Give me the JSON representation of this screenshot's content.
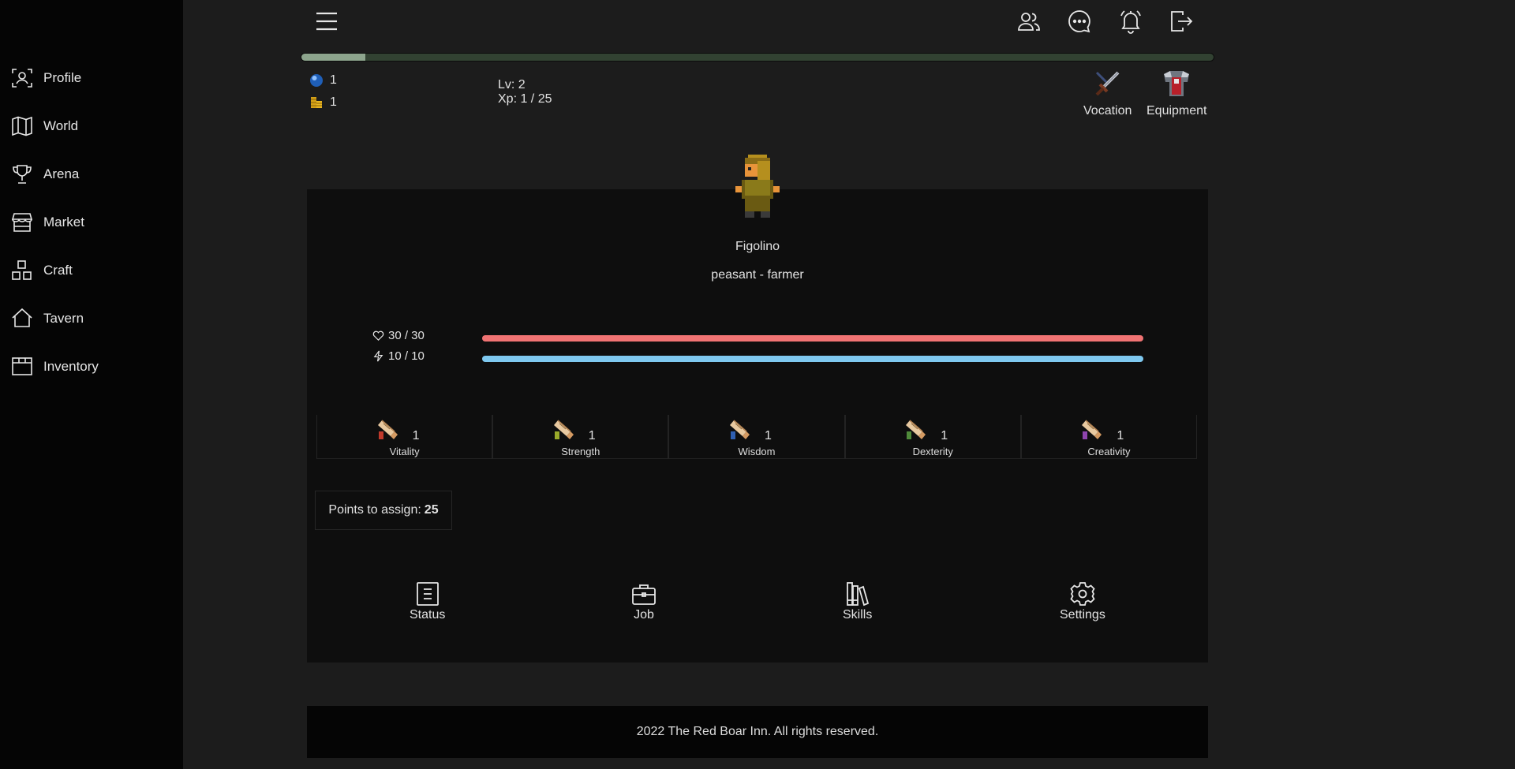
{
  "sidebar": {
    "items": [
      {
        "label": "Profile",
        "icon": "profile-icon"
      },
      {
        "label": "World",
        "icon": "map-icon"
      },
      {
        "label": "Arena",
        "icon": "trophy-icon"
      },
      {
        "label": "Market",
        "icon": "shop-icon"
      },
      {
        "label": "Craft",
        "icon": "blocks-icon"
      },
      {
        "label": "Tavern",
        "icon": "house-icon"
      },
      {
        "label": "Inventory",
        "icon": "box-icon"
      }
    ]
  },
  "topbar": {
    "icons": [
      "menu-icon",
      "friends-icon",
      "chat-icon",
      "notifications-icon",
      "logout-icon"
    ]
  },
  "xp_progress": 0.07,
  "currencies": {
    "orbs": "1",
    "gold": "1"
  },
  "level": {
    "lv_text": "Lv: 2",
    "xp_text": "Xp: 1 / 25"
  },
  "top_buttons": {
    "vocation": "Vocation",
    "equipment": "Equipment"
  },
  "character": {
    "name": "Figolino",
    "class": "peasant - farmer"
  },
  "stats": {
    "health": {
      "text": "30 / 30",
      "fraction": 1.0,
      "color": "#f07373"
    },
    "energy": {
      "text": "10 / 10",
      "fraction": 1.0,
      "color": "#7ec8ef"
    }
  },
  "attributes": [
    {
      "name": "Vitality",
      "value": "1",
      "color": "#c0392b"
    },
    {
      "name": "Strength",
      "value": "1",
      "color": "#9aaa2a"
    },
    {
      "name": "Wisdom",
      "value": "1",
      "color": "#2f5fb0"
    },
    {
      "name": "Dexterity",
      "value": "1",
      "color": "#4f8a3a"
    },
    {
      "name": "Creativity",
      "value": "1",
      "color": "#8e44ad"
    }
  ],
  "points": {
    "label": "Points to assign:",
    "value": "25"
  },
  "bottom_nav": {
    "status": "Status",
    "job": "Job",
    "skills": "Skills",
    "settings": "Settings"
  },
  "footer": {
    "text": "2022 The Red Boar Inn. All rights reserved."
  }
}
